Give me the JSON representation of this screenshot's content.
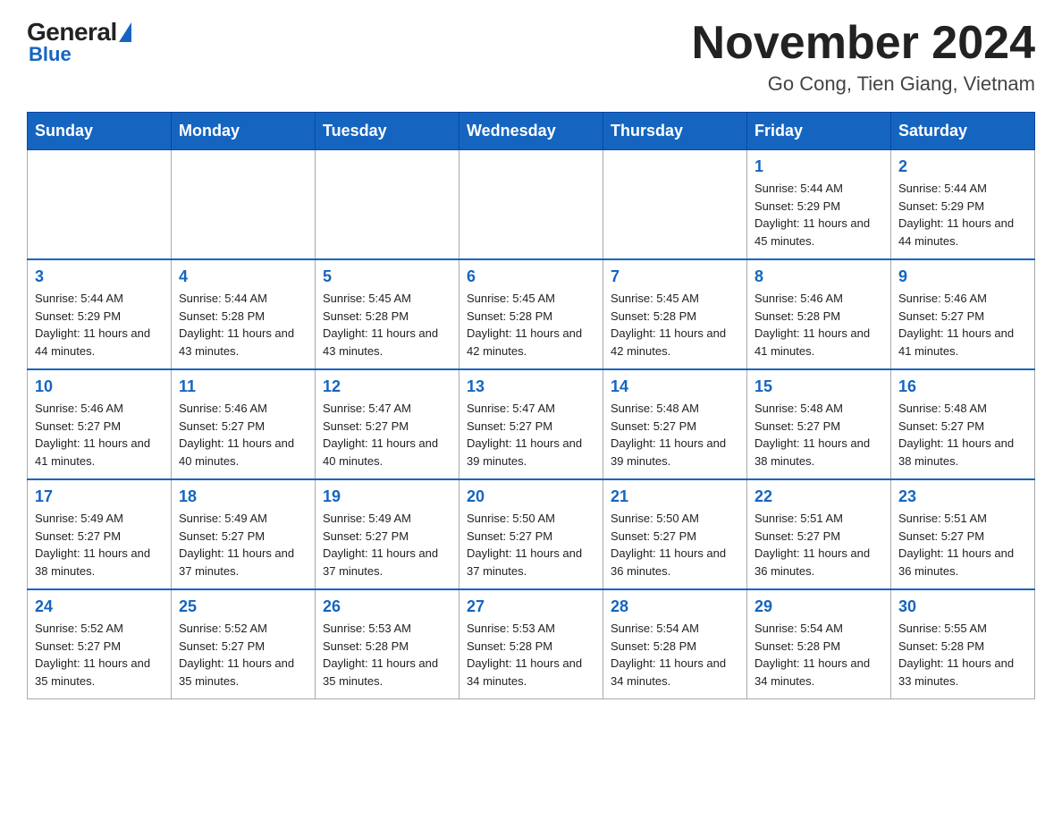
{
  "header": {
    "logo_general": "General",
    "logo_blue": "Blue",
    "main_title": "November 2024",
    "subtitle": "Go Cong, Tien Giang, Vietnam"
  },
  "calendar": {
    "days_of_week": [
      "Sunday",
      "Monday",
      "Tuesday",
      "Wednesday",
      "Thursday",
      "Friday",
      "Saturday"
    ],
    "weeks": [
      [
        {
          "day": "",
          "info": ""
        },
        {
          "day": "",
          "info": ""
        },
        {
          "day": "",
          "info": ""
        },
        {
          "day": "",
          "info": ""
        },
        {
          "day": "",
          "info": ""
        },
        {
          "day": "1",
          "info": "Sunrise: 5:44 AM\nSunset: 5:29 PM\nDaylight: 11 hours and 45 minutes."
        },
        {
          "day": "2",
          "info": "Sunrise: 5:44 AM\nSunset: 5:29 PM\nDaylight: 11 hours and 44 minutes."
        }
      ],
      [
        {
          "day": "3",
          "info": "Sunrise: 5:44 AM\nSunset: 5:29 PM\nDaylight: 11 hours and 44 minutes."
        },
        {
          "day": "4",
          "info": "Sunrise: 5:44 AM\nSunset: 5:28 PM\nDaylight: 11 hours and 43 minutes."
        },
        {
          "day": "5",
          "info": "Sunrise: 5:45 AM\nSunset: 5:28 PM\nDaylight: 11 hours and 43 minutes."
        },
        {
          "day": "6",
          "info": "Sunrise: 5:45 AM\nSunset: 5:28 PM\nDaylight: 11 hours and 42 minutes."
        },
        {
          "day": "7",
          "info": "Sunrise: 5:45 AM\nSunset: 5:28 PM\nDaylight: 11 hours and 42 minutes."
        },
        {
          "day": "8",
          "info": "Sunrise: 5:46 AM\nSunset: 5:28 PM\nDaylight: 11 hours and 41 minutes."
        },
        {
          "day": "9",
          "info": "Sunrise: 5:46 AM\nSunset: 5:27 PM\nDaylight: 11 hours and 41 minutes."
        }
      ],
      [
        {
          "day": "10",
          "info": "Sunrise: 5:46 AM\nSunset: 5:27 PM\nDaylight: 11 hours and 41 minutes."
        },
        {
          "day": "11",
          "info": "Sunrise: 5:46 AM\nSunset: 5:27 PM\nDaylight: 11 hours and 40 minutes."
        },
        {
          "day": "12",
          "info": "Sunrise: 5:47 AM\nSunset: 5:27 PM\nDaylight: 11 hours and 40 minutes."
        },
        {
          "day": "13",
          "info": "Sunrise: 5:47 AM\nSunset: 5:27 PM\nDaylight: 11 hours and 39 minutes."
        },
        {
          "day": "14",
          "info": "Sunrise: 5:48 AM\nSunset: 5:27 PM\nDaylight: 11 hours and 39 minutes."
        },
        {
          "day": "15",
          "info": "Sunrise: 5:48 AM\nSunset: 5:27 PM\nDaylight: 11 hours and 38 minutes."
        },
        {
          "day": "16",
          "info": "Sunrise: 5:48 AM\nSunset: 5:27 PM\nDaylight: 11 hours and 38 minutes."
        }
      ],
      [
        {
          "day": "17",
          "info": "Sunrise: 5:49 AM\nSunset: 5:27 PM\nDaylight: 11 hours and 38 minutes."
        },
        {
          "day": "18",
          "info": "Sunrise: 5:49 AM\nSunset: 5:27 PM\nDaylight: 11 hours and 37 minutes."
        },
        {
          "day": "19",
          "info": "Sunrise: 5:49 AM\nSunset: 5:27 PM\nDaylight: 11 hours and 37 minutes."
        },
        {
          "day": "20",
          "info": "Sunrise: 5:50 AM\nSunset: 5:27 PM\nDaylight: 11 hours and 37 minutes."
        },
        {
          "day": "21",
          "info": "Sunrise: 5:50 AM\nSunset: 5:27 PM\nDaylight: 11 hours and 36 minutes."
        },
        {
          "day": "22",
          "info": "Sunrise: 5:51 AM\nSunset: 5:27 PM\nDaylight: 11 hours and 36 minutes."
        },
        {
          "day": "23",
          "info": "Sunrise: 5:51 AM\nSunset: 5:27 PM\nDaylight: 11 hours and 36 minutes."
        }
      ],
      [
        {
          "day": "24",
          "info": "Sunrise: 5:52 AM\nSunset: 5:27 PM\nDaylight: 11 hours and 35 minutes."
        },
        {
          "day": "25",
          "info": "Sunrise: 5:52 AM\nSunset: 5:27 PM\nDaylight: 11 hours and 35 minutes."
        },
        {
          "day": "26",
          "info": "Sunrise: 5:53 AM\nSunset: 5:28 PM\nDaylight: 11 hours and 35 minutes."
        },
        {
          "day": "27",
          "info": "Sunrise: 5:53 AM\nSunset: 5:28 PM\nDaylight: 11 hours and 34 minutes."
        },
        {
          "day": "28",
          "info": "Sunrise: 5:54 AM\nSunset: 5:28 PM\nDaylight: 11 hours and 34 minutes."
        },
        {
          "day": "29",
          "info": "Sunrise: 5:54 AM\nSunset: 5:28 PM\nDaylight: 11 hours and 34 minutes."
        },
        {
          "day": "30",
          "info": "Sunrise: 5:55 AM\nSunset: 5:28 PM\nDaylight: 11 hours and 33 minutes."
        }
      ]
    ]
  }
}
